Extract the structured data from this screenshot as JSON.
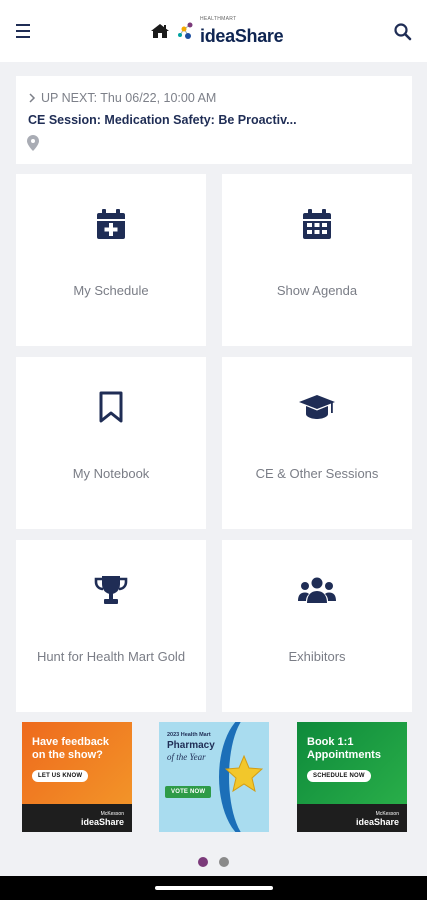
{
  "header": {
    "logo_small": "HEALTHMART",
    "logo_text": "ideaShare"
  },
  "upnext": {
    "label": "UP NEXT: Thu 06/22, 10:00 AM",
    "title": "CE Session: Medication Safety: Be Proactiv..."
  },
  "tiles": [
    {
      "label": "My Schedule",
      "icon": "calendar-plus-icon"
    },
    {
      "label": "Show Agenda",
      "icon": "calendar-grid-icon"
    },
    {
      "label": "My Notebook",
      "icon": "bookmark-icon"
    },
    {
      "label": "CE & Other Sessions",
      "icon": "graduation-cap-icon"
    },
    {
      "label": "Hunt for Health Mart Gold",
      "icon": "trophy-icon"
    },
    {
      "label": "Exhibitors",
      "icon": "users-icon"
    }
  ],
  "banners": [
    {
      "title_line1": "Have feedback",
      "title_line2": "on the show?",
      "button": "LET US KNOW",
      "logo": "ideaShare",
      "logo_small": "McKesson"
    },
    {
      "title_line1": "2023 Health Mart",
      "title_line2": "Pharmacy",
      "title_line3": "of the Year",
      "button": "VOTE NOW"
    },
    {
      "title_line1": "Book 1:1",
      "title_line2": "Appointments",
      "button": "SCHEDULE NOW",
      "logo": "ideaShare",
      "logo_small": "McKesson"
    }
  ],
  "carousel": {
    "active_index": 0,
    "count": 2
  },
  "colors": {
    "navy": "#1f2d55",
    "label_gray": "#7a7d86",
    "background": "#f0f1f4",
    "dot_active": "#7b3a7a",
    "dot_inactive": "#8a8a8a"
  }
}
